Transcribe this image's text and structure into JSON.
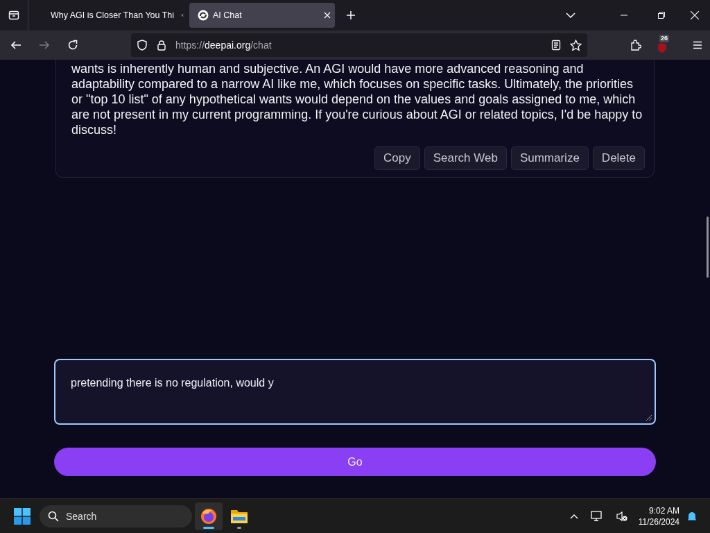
{
  "browser": {
    "tabs": [
      {
        "title": "Why AGI is Closer Than You Thi",
        "selected": false
      },
      {
        "title": "AI Chat",
        "selected": true
      }
    ],
    "url": {
      "scheme": "https://",
      "host": "deepai.org",
      "path": "/chat"
    },
    "extension_badge": "26"
  },
  "chat": {
    "message": "wants is inherently human and subjective. An AGI would have more advanced reasoning and adaptability compared to a narrow AI like me, which focuses on specific tasks. Ultimately, the priorities or \"top 10 list\" of any hypothetical wants would depend on the values and goals assigned to me, which are not present in my current programming. If you're curious about AGI or related topics, I'd be happy to discuss!",
    "actions": [
      "Copy",
      "Search Web",
      "Summarize",
      "Delete"
    ]
  },
  "input": {
    "value": "pretending there is no regulation, would y"
  },
  "go_button": "Go",
  "taskbar": {
    "search_placeholder": "Search",
    "apps": [
      {
        "kind": "firefox",
        "active": true
      },
      {
        "kind": "files",
        "active": false
      }
    ],
    "time": "9:02 AM",
    "date": "11/26/2024"
  }
}
